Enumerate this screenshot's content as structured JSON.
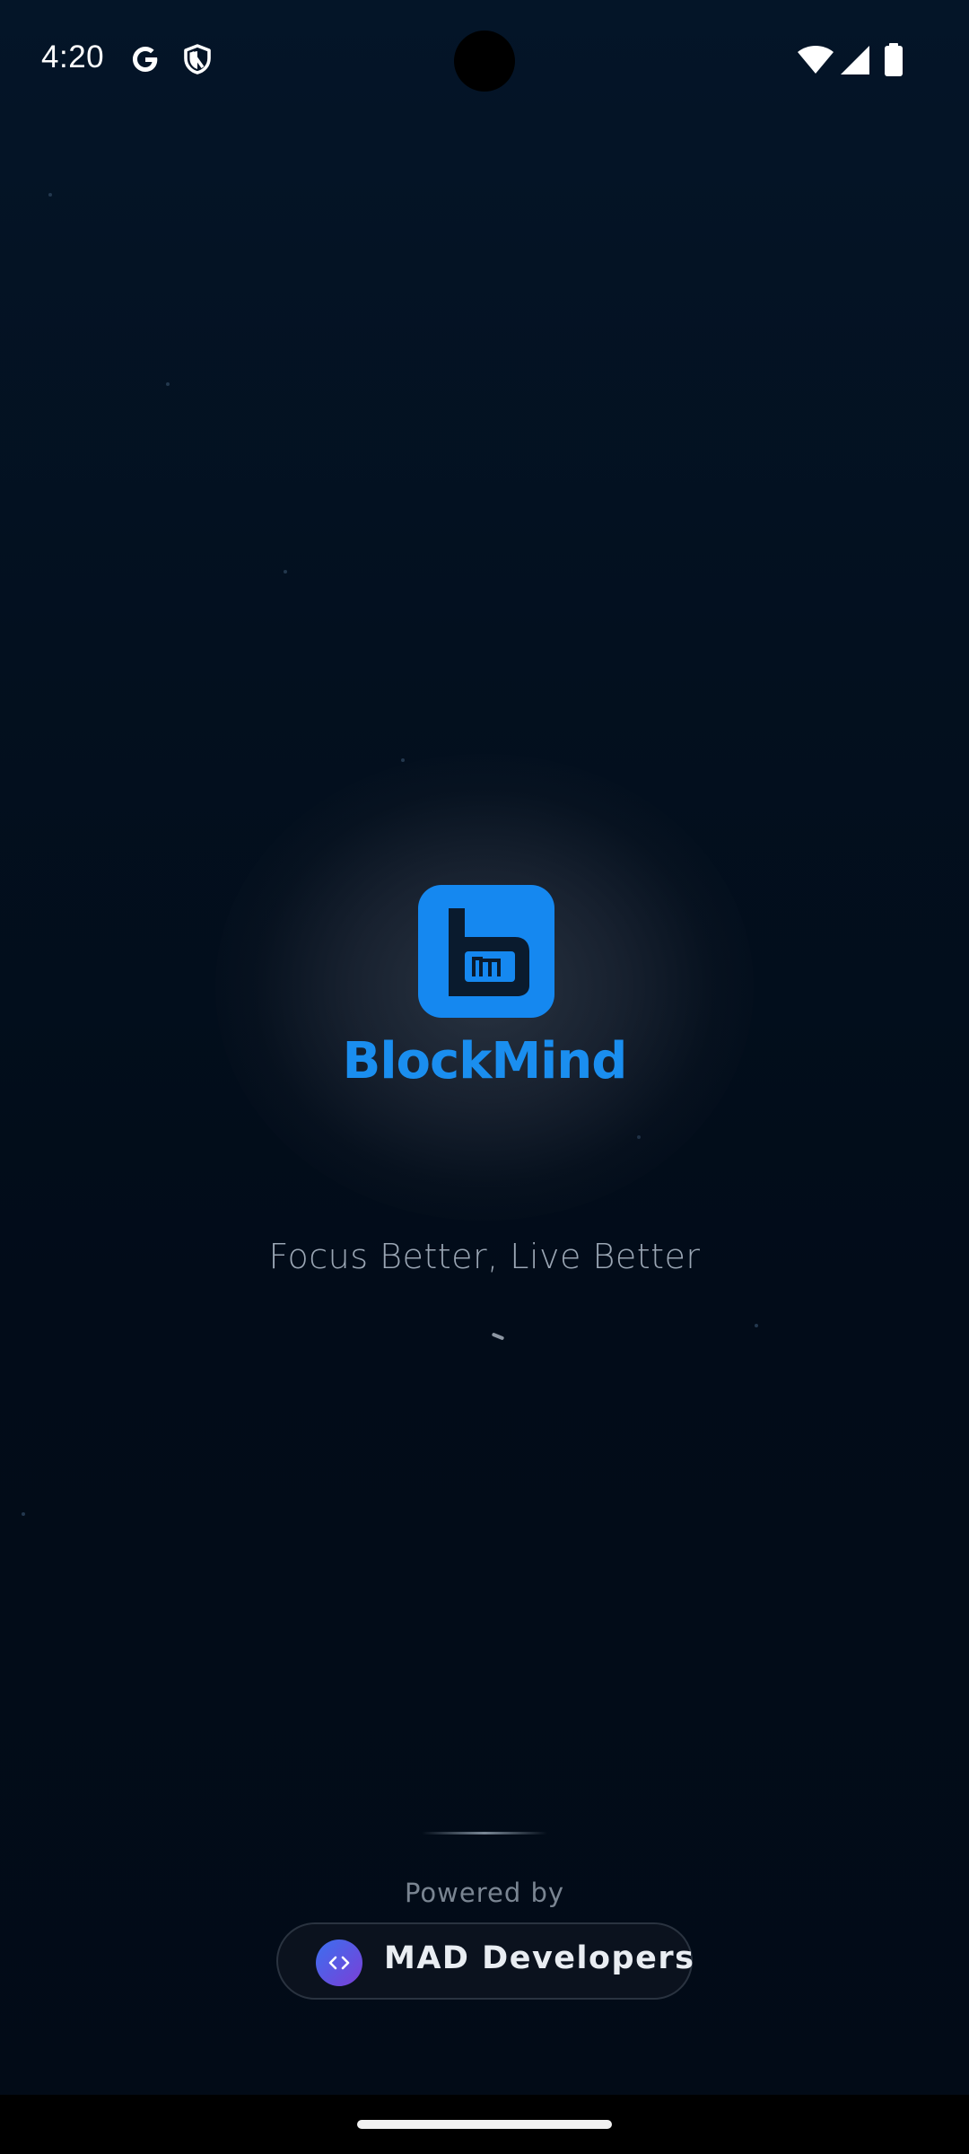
{
  "status_bar": {
    "time": "4:20",
    "left_icons": [
      "google-icon",
      "shield-icon"
    ],
    "right_icons": [
      "wifi-icon",
      "signal-icon",
      "battery-icon"
    ]
  },
  "splash": {
    "app_name": "BlockMind",
    "logo_icon": "blockmind-logo-icon",
    "logo_letters": "bm",
    "accent_color": "#1588f0",
    "tagline": "Focus Better, Live Better"
  },
  "footer": {
    "powered_by": "Powered by",
    "developer_name": "MAD Developers",
    "developer_icon": "code-icon"
  },
  "colors": {
    "background": "#031223",
    "text_primary": "#e9edf2",
    "text_secondary": "#9aa6b4",
    "badge_gradient": [
      "#3b6ff0",
      "#7b3fd6"
    ]
  }
}
